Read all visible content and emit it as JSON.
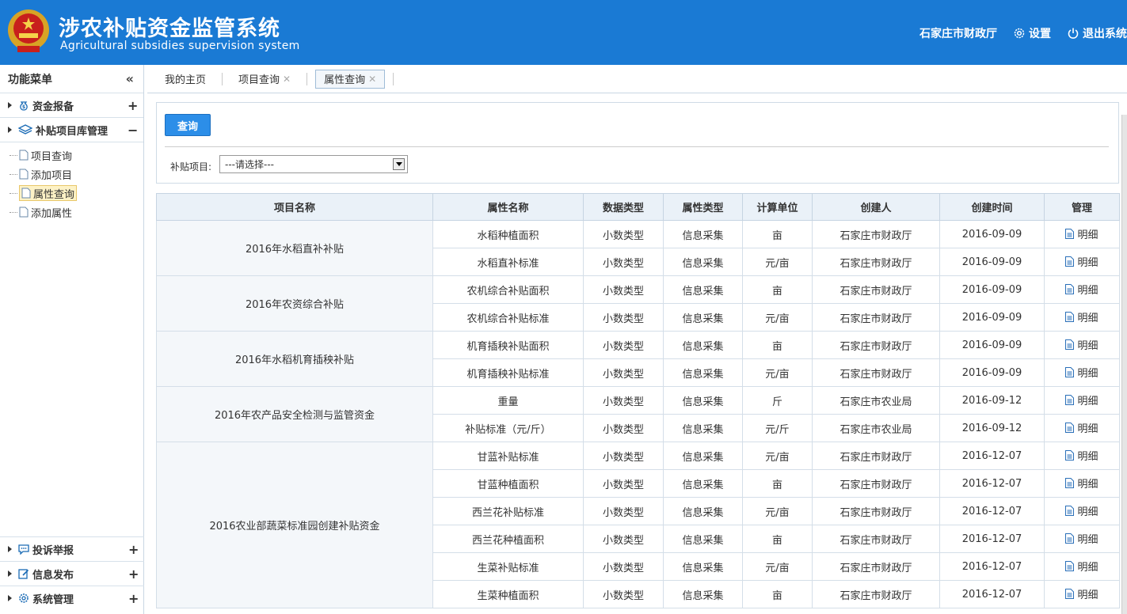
{
  "header": {
    "title_cn": "涉农补贴资金监管系统",
    "title_en": "Agricultural subsidies supervision system",
    "user": "石家庄市财政厅",
    "settings_label": "设置",
    "logout_label": "退出系统",
    "bg_color": "#1a7ad4"
  },
  "sidebar": {
    "title": "功能菜单",
    "collapse_icon": "«",
    "groups_top": [
      {
        "label": "资金报备",
        "icon": "money-bag-icon",
        "toggle": "+"
      },
      {
        "label": "补贴项目库管理",
        "icon": "layers-icon",
        "toggle": "−"
      }
    ],
    "sub_items": [
      "项目查询",
      "添加项目",
      "属性查询",
      "添加属性"
    ],
    "active_sub": "属性查询",
    "groups_bottom": [
      {
        "label": "投诉举报",
        "icon": "chat-icon",
        "toggle": "+"
      },
      {
        "label": "信息发布",
        "icon": "edit-icon",
        "toggle": "+"
      },
      {
        "label": "系统管理",
        "icon": "gear-icon",
        "toggle": "+"
      }
    ]
  },
  "tabs": [
    {
      "label": "我的主页",
      "closable": false,
      "active": false
    },
    {
      "label": "项目查询",
      "closable": true,
      "active": false
    },
    {
      "label": "属性查询",
      "closable": true,
      "active": true
    }
  ],
  "query": {
    "button_label": "查询",
    "field_label": "补贴项目:",
    "select_value": "---请选择---"
  },
  "table": {
    "columns": [
      "项目名称",
      "属性名称",
      "数据类型",
      "属性类型",
      "计算单位",
      "创建人",
      "创建时间",
      "管理"
    ],
    "detail_label": "明细",
    "groups": [
      {
        "project": "2016年水稻直补补贴",
        "rows": [
          [
            "水稻种植面积",
            "小数类型",
            "信息采集",
            "亩",
            "石家庄市财政厅",
            "2016-09-09"
          ],
          [
            "水稻直补标准",
            "小数类型",
            "信息采集",
            "元/亩",
            "石家庄市财政厅",
            "2016-09-09"
          ]
        ]
      },
      {
        "project": "2016年农资综合补贴",
        "rows": [
          [
            "农机综合补贴面积",
            "小数类型",
            "信息采集",
            "亩",
            "石家庄市财政厅",
            "2016-09-09"
          ],
          [
            "农机综合补贴标准",
            "小数类型",
            "信息采集",
            "元/亩",
            "石家庄市财政厅",
            "2016-09-09"
          ]
        ]
      },
      {
        "project": "2016年水稻机育插秧补贴",
        "rows": [
          [
            "机育插秧补贴面积",
            "小数类型",
            "信息采集",
            "亩",
            "石家庄市财政厅",
            "2016-09-09"
          ],
          [
            "机育插秧补贴标准",
            "小数类型",
            "信息采集",
            "元/亩",
            "石家庄市财政厅",
            "2016-09-09"
          ]
        ]
      },
      {
        "project": "2016年农产品安全检测与监管资金",
        "rows": [
          [
            "重量",
            "小数类型",
            "信息采集",
            "斤",
            "石家庄市农业局",
            "2016-09-12"
          ],
          [
            "补贴标准（元/斤）",
            "小数类型",
            "信息采集",
            "元/斤",
            "石家庄市农业局",
            "2016-09-12"
          ]
        ]
      },
      {
        "project": "2016农业部蔬菜标准园创建补贴资金",
        "rows": [
          [
            "甘蓝补贴标准",
            "小数类型",
            "信息采集",
            "元/亩",
            "石家庄市财政厅",
            "2016-12-07"
          ],
          [
            "甘蓝种植面积",
            "小数类型",
            "信息采集",
            "亩",
            "石家庄市财政厅",
            "2016-12-07"
          ],
          [
            "西兰花补贴标准",
            "小数类型",
            "信息采集",
            "元/亩",
            "石家庄市财政厅",
            "2016-12-07"
          ],
          [
            "西兰花种植面积",
            "小数类型",
            "信息采集",
            "亩",
            "石家庄市财政厅",
            "2016-12-07"
          ],
          [
            "生菜补贴标准",
            "小数类型",
            "信息采集",
            "元/亩",
            "石家庄市财政厅",
            "2016-12-07"
          ],
          [
            "生菜种植面积",
            "小数类型",
            "信息采集",
            "亩",
            "石家庄市财政厅",
            "2016-12-07"
          ]
        ]
      }
    ]
  }
}
